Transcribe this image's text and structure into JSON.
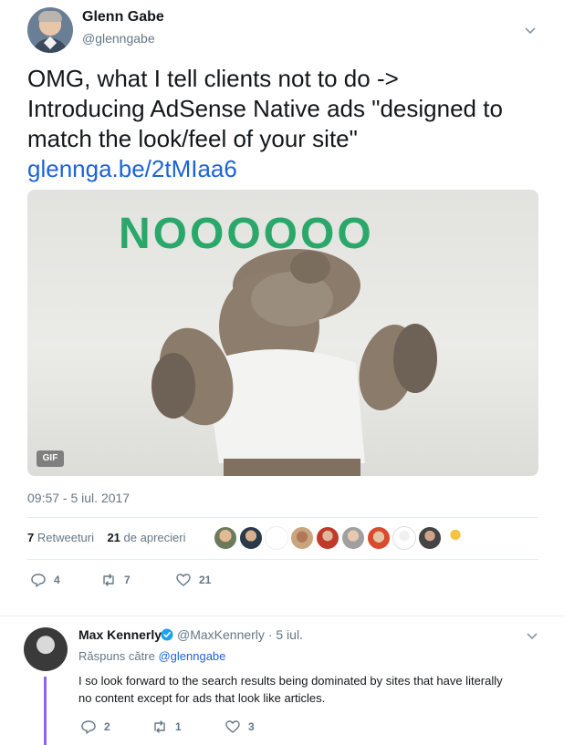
{
  "tweet": {
    "author": {
      "name": "Glenn Gabe",
      "handle": "@glenngabe"
    },
    "text_lines": [
      "OMG, what I tell clients not to do ->",
      "Introducing AdSense Native ads \"designed to",
      "match the look/feel of your site\""
    ],
    "link": "glennga.be/2tMIaa6",
    "media": {
      "caption_text": "NOOOOOO",
      "badge": "GIF"
    },
    "timestamp": "09:57 - 5 iul. 2017",
    "stats": {
      "retweets_count": "7",
      "retweets_label": "Retweeturi",
      "likes_count": "21",
      "likes_label": "de aprecieri"
    },
    "likers_count": 10,
    "actions": {
      "replies": "4",
      "retweets": "7",
      "likes": "21"
    }
  },
  "reply": {
    "author": {
      "name": "Max Kennerly",
      "handle": "@MaxKennerly",
      "dot": "·",
      "date": "5 iul."
    },
    "replying_to_label": "Răspuns către",
    "replying_to_mention": "@glenngabe",
    "text_lines": [
      "I so look forward to the search results being dominated by sites that have literally",
      "no content except for ads that look like articles."
    ],
    "actions": {
      "replies": "2",
      "retweets": "1",
      "likes": "3"
    }
  },
  "colors": {
    "link": "#1b63d8",
    "secondary_text": "#657786",
    "thread_line": "#8a64f0",
    "gif_text_green": "#2aa86a",
    "verified": "#1da1f2"
  },
  "icons": [
    "chevron-down-icon",
    "reply-icon",
    "retweet-icon",
    "heart-icon",
    "verified-badge-icon"
  ]
}
